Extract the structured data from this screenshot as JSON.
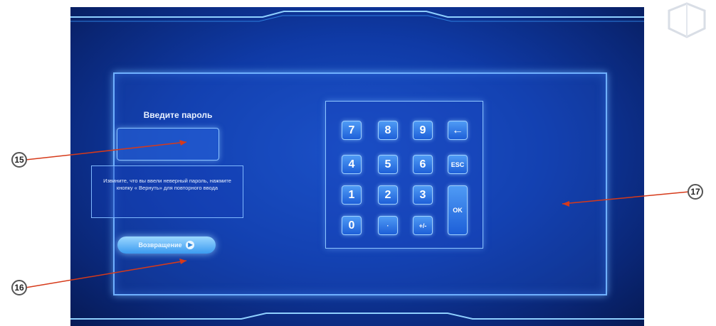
{
  "prompt": {
    "title": "Введите пароль",
    "password_value": ""
  },
  "error_message": "Извините, что вы ввели неверный пароль, нажмите кнопку « Вернуть» для повторного ввода",
  "return_button": {
    "label": "Возвращение",
    "icon": "arrow-right-icon"
  },
  "keypad": {
    "keys": [
      "7",
      "8",
      "9",
      "←",
      "4",
      "5",
      "6",
      "ESC",
      "1",
      "2",
      "3",
      "OK",
      "0",
      "·",
      "+/-"
    ]
  },
  "callouts": {
    "c15": "15",
    "c16": "16",
    "c17": "17"
  },
  "colors": {
    "accent": "#6fb0ff",
    "callout_line": "#d63a1a",
    "background": "#0f3aa6"
  }
}
